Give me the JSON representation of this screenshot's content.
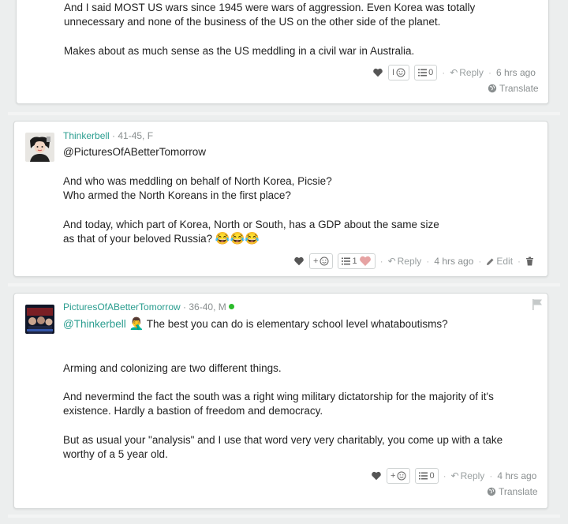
{
  "comments": [
    {
      "lines": [
        "And I said MOST US wars since 1945 were wars of aggression. Even Korea was totally",
        "unnecessary and none of the business of the US on the other side of the planet.",
        "",
        "Makes about as much sense as the US meddling in a civil war in Australia."
      ],
      "reaction_label": "I",
      "list_count": "0",
      "reply_label": "Reply",
      "time": "6 hrs ago",
      "translate_label": "Translate"
    },
    {
      "username": "Thinkerbell",
      "meta": " · 41-45, F",
      "mention": "@PicturesOfABetterTomorrow",
      "lines": [
        "And who was meddling on behalf of North Korea, Picsie?",
        "Who armed the North Koreans in the first place?",
        "",
        "And today, which part of Korea, North or South, has a GDP about the same size",
        "as that of your beloved Russia?"
      ],
      "trailing_emoji": "😂😂😂",
      "reaction_label": "+",
      "list_count": "1",
      "reply_label": "Reply",
      "time": "4 hrs ago",
      "edit_label": "Edit"
    },
    {
      "username": "PicturesOfABetterTomorrow",
      "meta": " · 36-40, M",
      "mention": "@Thinkerbell",
      "mention_emoji": "🤦‍♂️",
      "mention_text": "The best you can do is elementary school level whataboutisms?",
      "lines": [
        "Arming and colonizing are two different things.",
        "",
        "And nevermind the fact the south was a right wing military dictatorship for the majority of it's",
        "existence. Hardly a bastion of freedom and democracy.",
        "",
        "But as usual your \"analysis\" and I use that word very very charitably, you come up with a take",
        "worthy of a 5 year old."
      ],
      "reaction_label": "+",
      "list_count": "0",
      "reply_label": "Reply",
      "time": "4 hrs ago",
      "translate_label": "Translate"
    }
  ],
  "colors": {
    "accent": "#2a9d8f",
    "online": "#2bbb2b",
    "muted": "#8a8f90"
  }
}
